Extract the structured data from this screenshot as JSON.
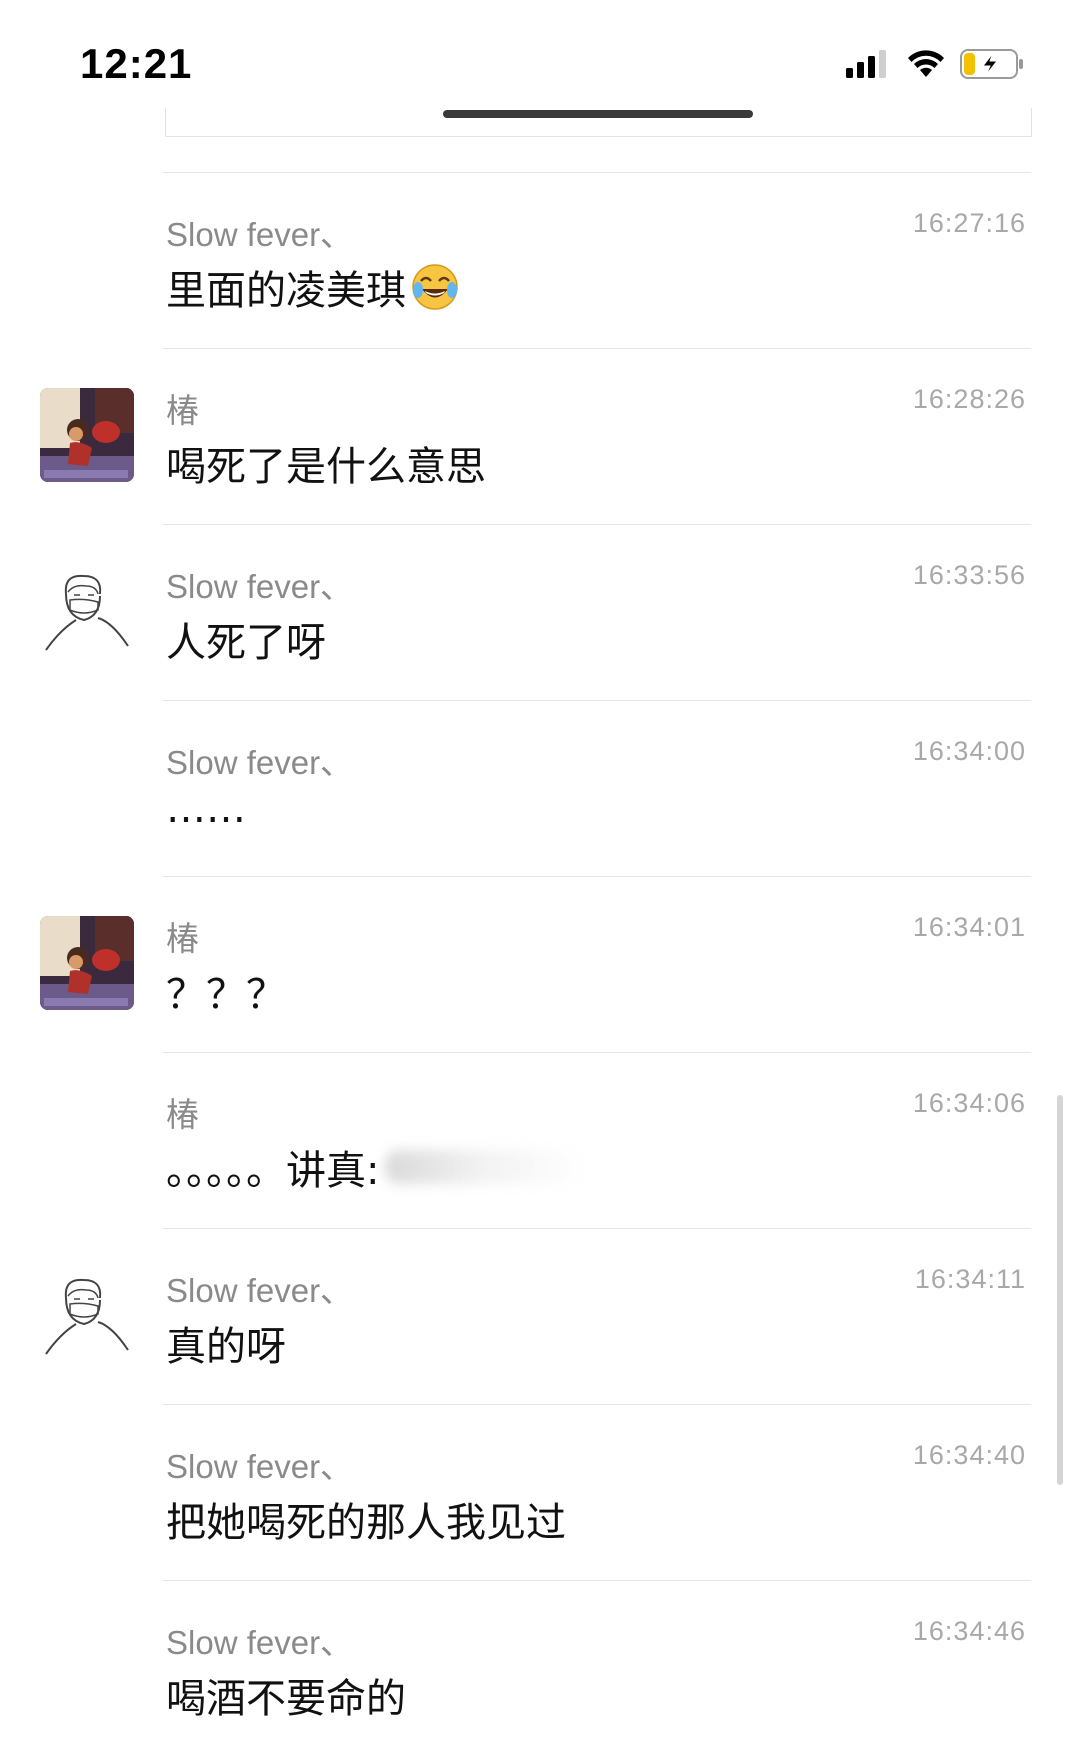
{
  "status_bar": {
    "time": "12:21",
    "signal_icon": "cellular-signal-icon",
    "wifi_icon": "wifi-icon",
    "battery_icon": "battery-charging-icon",
    "battery_color": "#f2c200"
  },
  "messages": [
    {
      "sender": "Slow fever、",
      "time": "16:27:16",
      "text": "里面的凌美琪",
      "emoji": "tears-of-joy-icon",
      "avatar": ""
    },
    {
      "sender": "椿",
      "time": "16:28:26",
      "text": "喝死了是什么意思",
      "avatar": "cartoon-girl-avatar"
    },
    {
      "sender": "Slow fever、",
      "time": "16:33:56",
      "text": "人死了呀",
      "avatar": "sketch-man-avatar"
    },
    {
      "sender": "Slow fever、",
      "time": "16:34:00",
      "text": "……",
      "avatar": ""
    },
    {
      "sender": "椿",
      "time": "16:34:01",
      "text": "？？？",
      "avatar": "cartoon-girl-avatar"
    },
    {
      "sender": "椿",
      "time": "16:34:06",
      "text": "。。。。。讲真:",
      "avatar": ""
    },
    {
      "sender": "Slow fever、",
      "time": "16:34:11",
      "text": "真的呀",
      "avatar": "sketch-man-avatar"
    },
    {
      "sender": "Slow fever、",
      "time": "16:34:40",
      "text": "把她喝死的那人我见过",
      "avatar": ""
    },
    {
      "sender": "Slow fever、",
      "time": "16:34:46",
      "text": "喝酒不要命的",
      "avatar": ""
    }
  ]
}
